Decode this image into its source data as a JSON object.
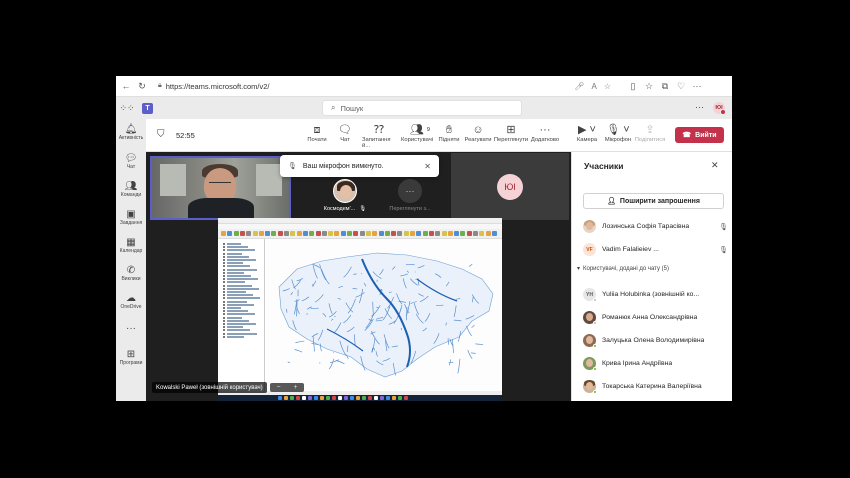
{
  "browser": {
    "url": "https://teams.microsoft.com/v2/"
  },
  "teams_bar": {
    "search_placeholder": "Пошук",
    "user_initials": "ЮІ"
  },
  "rail": [
    {
      "label": "Активність",
      "icon": "bell-icon"
    },
    {
      "label": "Чат",
      "icon": "chat-icon"
    },
    {
      "label": "Команди",
      "icon": "teams-icon"
    },
    {
      "label": "Завдання",
      "icon": "tasks-icon"
    },
    {
      "label": "Календар",
      "icon": "calendar-icon"
    },
    {
      "label": "Виклики",
      "icon": "phone-icon"
    },
    {
      "label": "OneDrive",
      "icon": "cloud-icon"
    },
    {
      "label": "",
      "icon": "more-icon"
    },
    {
      "label": "Програми",
      "icon": "apps-icon"
    }
  ],
  "meeting": {
    "timer": "52:55",
    "controls": [
      {
        "label": "Почати",
        "icon": "record-icon"
      },
      {
        "label": "Чат",
        "icon": "chat-icon"
      },
      {
        "label": "Запитання й...",
        "icon": "qa-icon"
      },
      {
        "label": "Користувачі",
        "icon": "people-icon",
        "badge": "9"
      },
      {
        "label": "Підняти",
        "icon": "raise-hand-icon"
      },
      {
        "label": "Реагувати",
        "icon": "react-icon"
      },
      {
        "label": "Переглянути",
        "icon": "view-icon"
      },
      {
        "label": "Додатково",
        "icon": "more-icon"
      },
      {
        "label": "Камера",
        "icon": "camera-icon"
      },
      {
        "label": "Мікрофон",
        "icon": "mic-icon"
      },
      {
        "label": "Поділитися",
        "icon": "share-icon"
      }
    ],
    "leave_label": "Вийти",
    "mic_notice": "Ваш мікрофон вимкнуто.",
    "tile_kosmo": "Космодем'...",
    "tile_more": "Переглянути з...",
    "tile_initials": "ЮІ",
    "presenter_label": "Kowalski Paweł (зовнішній користувач)"
  },
  "panel": {
    "title": "Учасники",
    "invite_label": "Поширити запрошення",
    "section_label": "Користувачі, додані до чату (5)",
    "top_participants": [
      {
        "name": "Лозинська Софія Тарасівна",
        "initials": "",
        "muted": true
      },
      {
        "name": "Vadim Falalieiev ...",
        "initials": "VF",
        "muted": true
      }
    ],
    "chat_participants": [
      {
        "name": "Yuliia Holubinka (зовнішній ко...",
        "initials": "YH"
      },
      {
        "name": "Романюк Анна Олександрівна",
        "initials": ""
      },
      {
        "name": "Залуцька Олена Володимирівна",
        "initials": ""
      },
      {
        "name": "Крива Ірина Андріївна",
        "initials": ""
      },
      {
        "name": "Токарська Катерина Валеріївна",
        "initials": ""
      }
    ]
  }
}
